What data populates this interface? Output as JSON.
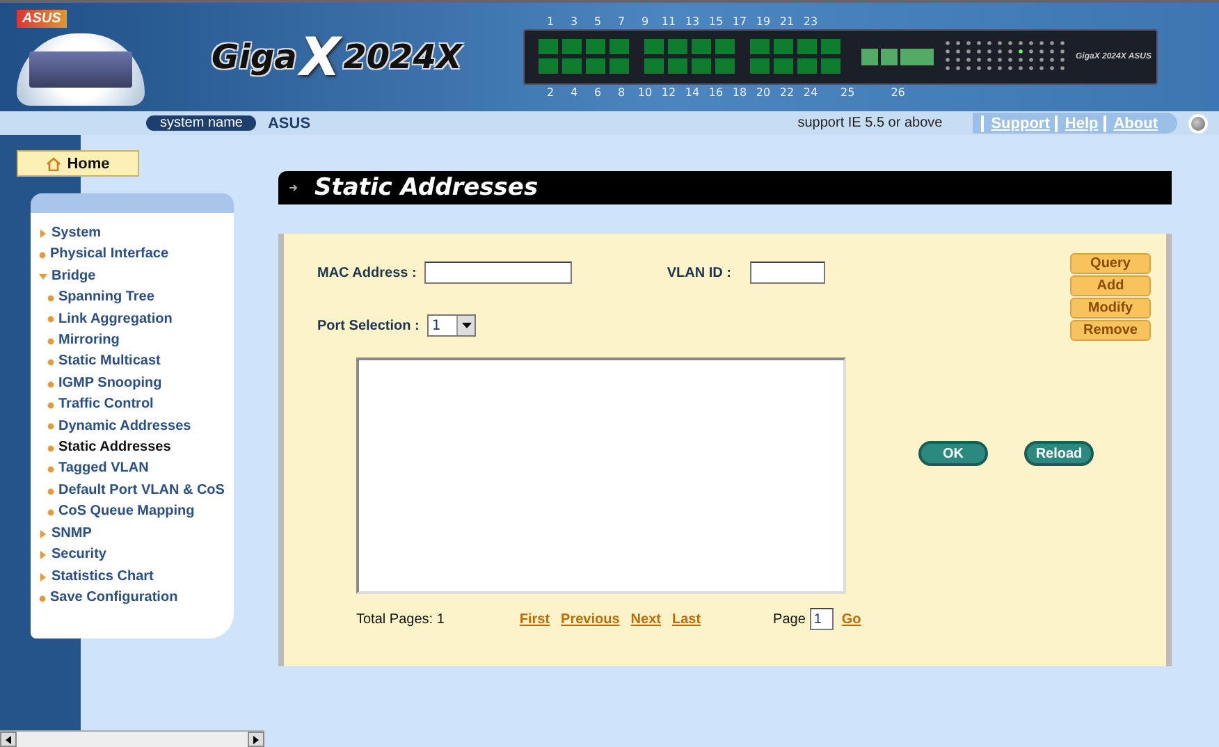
{
  "header": {
    "brand": "ASUS",
    "product": {
      "name": "Giga",
      "mark": "X",
      "model": "2024X"
    },
    "panel": {
      "top_ports": [
        "1",
        "3",
        "5",
        "7",
        "9",
        "11",
        "13",
        "15",
        "17",
        "19",
        "21",
        "23"
      ],
      "bottom_ports": [
        "2",
        "4",
        "6",
        "8",
        "10",
        "12",
        "14",
        "16",
        "18",
        "20",
        "22",
        "24"
      ],
      "uplinks": [
        "25",
        "26"
      ],
      "brand": "ASUS",
      "product": "GigaX 2024X"
    },
    "system_name_label": "system name",
    "system_name": "ASUS",
    "support_note": "support IE 5.5 or above",
    "links": [
      {
        "label": "Support"
      },
      {
        "label": "Help"
      },
      {
        "label": "About"
      }
    ]
  },
  "home_tab": {
    "label": "Home"
  },
  "menu": [
    {
      "label": "System",
      "kind": "group",
      "expanded": false,
      "selected": false
    },
    {
      "label": "Physical Interface",
      "kind": "link",
      "selected": false
    },
    {
      "label": "Bridge",
      "kind": "group",
      "expanded": true,
      "selected": false,
      "children": [
        {
          "label": "Spanning Tree",
          "kind": "link",
          "selected": false
        },
        {
          "label": "Link Aggregation",
          "kind": "link",
          "selected": false
        },
        {
          "label": "Mirroring",
          "kind": "link",
          "selected": false
        },
        {
          "label": "Static Multicast",
          "kind": "link",
          "selected": false
        },
        {
          "label": "IGMP Snooping",
          "kind": "link",
          "selected": false
        },
        {
          "label": "Traffic Control",
          "kind": "link",
          "selected": false
        },
        {
          "label": "Dynamic Addresses",
          "kind": "link",
          "selected": false
        },
        {
          "label": "Static Addresses",
          "kind": "link",
          "selected": true
        },
        {
          "label": "Tagged VLAN",
          "kind": "link",
          "selected": false
        },
        {
          "label": "Default Port VLAN & CoS",
          "kind": "link",
          "selected": false
        },
        {
          "label": "CoS Queue Mapping",
          "kind": "link",
          "selected": false
        }
      ]
    },
    {
      "label": "SNMP",
      "kind": "group",
      "expanded": false,
      "selected": false
    },
    {
      "label": "Security",
      "kind": "group",
      "expanded": false,
      "selected": false
    },
    {
      "label": "Statistics Chart",
      "kind": "group",
      "expanded": false,
      "selected": false
    },
    {
      "label": "Save Configuration",
      "kind": "link",
      "selected": false
    }
  ],
  "page": {
    "title": "Static Addresses"
  },
  "form": {
    "fields": [
      {
        "label": "MAC Address :"
      },
      {
        "label": "VLAN ID :"
      }
    ],
    "port_selection": {
      "label": "Port Selection :",
      "value": "1"
    },
    "actions": [
      "Query",
      "Add",
      "Modify",
      "Remove"
    ],
    "footer": {
      "total": "Total Pages: 1",
      "nav": [
        "First",
        "Previous",
        "Next",
        "Last"
      ],
      "page_label": "Page",
      "page_value": "1",
      "go": "Go"
    },
    "buttons": [
      "OK",
      "Reload"
    ]
  }
}
